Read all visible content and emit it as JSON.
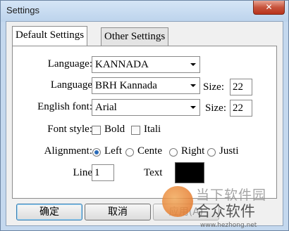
{
  "window": {
    "title": "Settings",
    "close_label": "✕"
  },
  "tabs": [
    {
      "label": "Default Settings",
      "active": true
    },
    {
      "label": "Other Settings",
      "active": false
    }
  ],
  "form": {
    "language_label": "Language:",
    "language_value": "KANNADA",
    "font_label": "Language",
    "font_value": "BRH Kannada",
    "size_label": "Size:",
    "size_value": "22",
    "english_font_label": "English font:",
    "english_font_value": "Arial",
    "english_size_label": "Size:",
    "english_size_value": "22",
    "font_style_label": "Font style:",
    "bold_label": "Bold",
    "italic_label": "Itali",
    "bold_checked": false,
    "italic_checked": false,
    "alignment_label": "Alignment:",
    "align_left": "Left",
    "align_center": "Cente",
    "align_right": "Right",
    "align_justify": "Justi",
    "alignment_selected": "Left",
    "line_label": "Line",
    "line_value": "1",
    "text_label": "Text",
    "text_color": "#000000"
  },
  "buttons": {
    "ok": "确定",
    "cancel": "取消",
    "apply": "应用(A)"
  },
  "watermark": {
    "line1": "当下软件园",
    "line2": "合众软件",
    "url": "www.hezhong.net"
  }
}
